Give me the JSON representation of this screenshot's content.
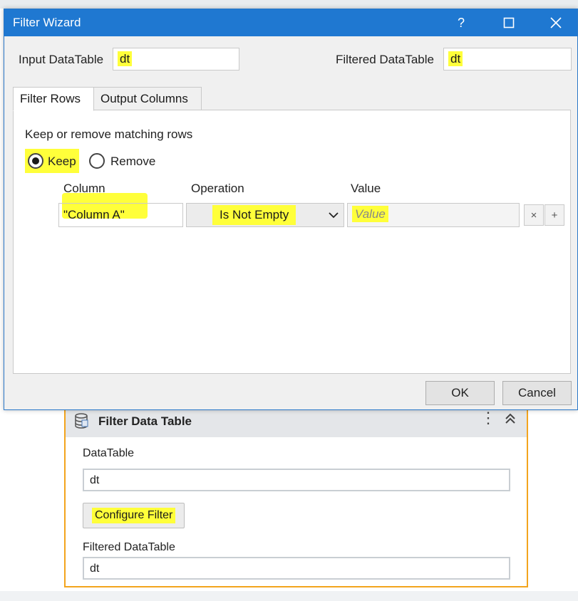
{
  "dialog": {
    "title": "Filter Wizard",
    "help_label": "?",
    "input_datatable_label": "Input DataTable",
    "input_datatable_value": "dt",
    "filtered_datatable_label": "Filtered DataTable",
    "filtered_datatable_value": "dt",
    "tabs": [
      {
        "label": "Filter Rows"
      },
      {
        "label": "Output Columns"
      }
    ],
    "keep_remove_label": "Keep or remove matching rows",
    "keep_label": "Keep",
    "remove_label": "Remove",
    "keep_selected": true,
    "columns": {
      "column": "Column",
      "operation": "Operation",
      "value": "Value"
    },
    "row": {
      "column_value": "\"Column A\"",
      "operation_value": "Is Not Empty",
      "value_placeholder": "Value",
      "remove_glyph": "×",
      "add_glyph": "+"
    },
    "ok_label": "OK",
    "cancel_label": "Cancel",
    "accent_color": "#1f78d1",
    "highlight_color": "#ffff3a"
  },
  "card": {
    "title": "Filter Data Table",
    "datatable_label": "DataTable",
    "datatable_value": "dt",
    "configure_button": "Configure Filter",
    "filtered_label": "Filtered DataTable",
    "filtered_value": "dt",
    "border_color": "#f3a41d"
  }
}
